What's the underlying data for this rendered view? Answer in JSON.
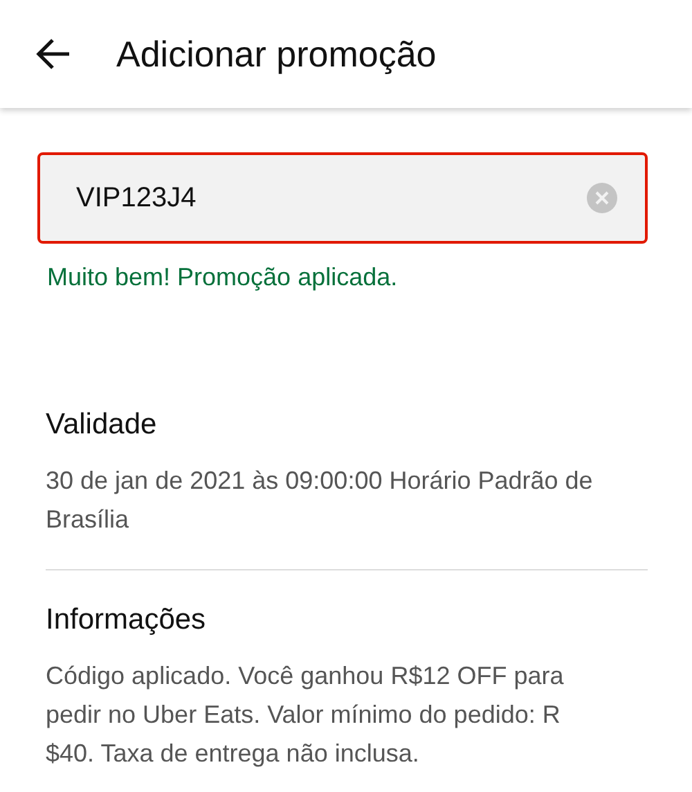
{
  "header": {
    "title": "Adicionar promoção"
  },
  "promo_field": {
    "value": "VIP123J4",
    "error_border": true
  },
  "success_message": "Muito bem! Promoção aplicada.",
  "sections": [
    {
      "title": "Validade",
      "body": "30 de jan de 2021 às 09:00:00 Horário Padrão de Brasília",
      "divider": true
    },
    {
      "title": "Informações",
      "body": "Código aplicado. Você ganhou R$12 OFF para pedir no Uber Eats. Valor mínimo do pedido: R $40. Taxa de entrega não inclusa.",
      "divider": false
    }
  ]
}
